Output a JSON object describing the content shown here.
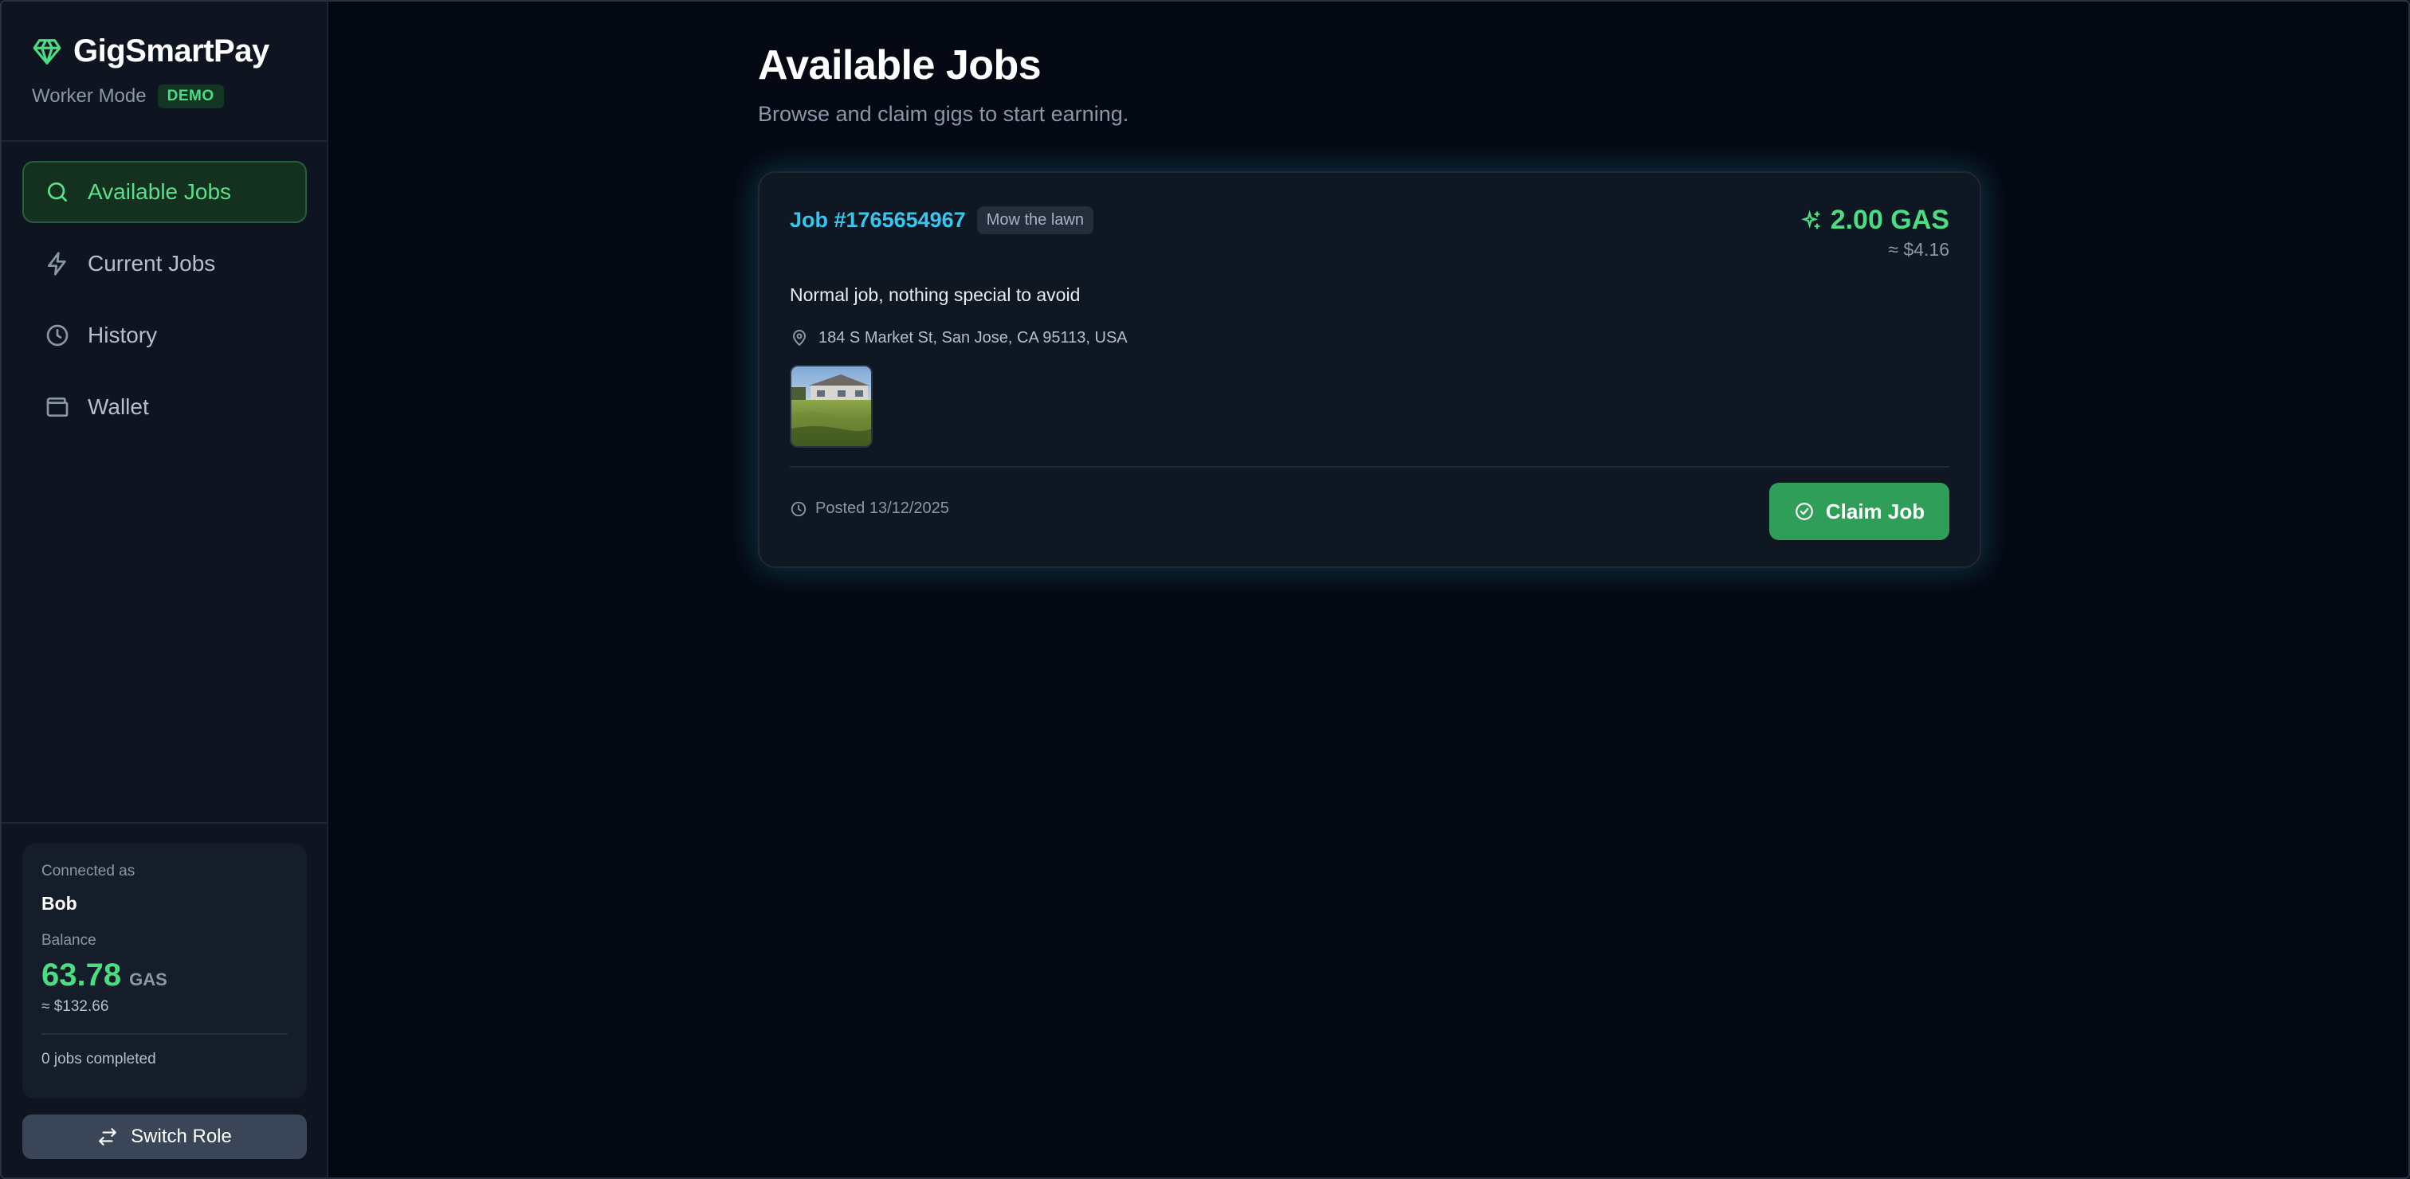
{
  "app": {
    "name": "GigSmartPay",
    "mode": "Worker Mode",
    "badge": "DEMO"
  },
  "sidebar": {
    "items": [
      {
        "label": "Available Jobs",
        "icon": "search-icon",
        "active": true
      },
      {
        "label": "Current Jobs",
        "icon": "lightning-icon",
        "active": false
      },
      {
        "label": "History",
        "icon": "clock-icon",
        "active": false
      },
      {
        "label": "Wallet",
        "icon": "wallet-icon",
        "active": false
      }
    ]
  },
  "account": {
    "connected_label": "Connected as",
    "name": "Bob",
    "balance_label": "Balance",
    "balance": "63.78",
    "unit": "GAS",
    "usd": "≈ $132.66",
    "jobs_completed": "0 jobs completed"
  },
  "switch_role": {
    "label": "Switch Role"
  },
  "page": {
    "title": "Available Jobs",
    "subtitle": "Browse and claim gigs to start earning."
  },
  "job": {
    "id_label": "Job #1765654967",
    "tag": "Mow the lawn",
    "price": "2.00 GAS",
    "price_usd": "≈ $4.16",
    "description": "Normal job, nothing special to avoid",
    "location": "184 S Market St, San Jose, CA 95113, USA",
    "posted": "Posted 13/12/2025",
    "claim_label": "Claim Job"
  },
  "colors": {
    "accent": "#4ade80",
    "link": "#38c5ee",
    "button": "#2f9e58",
    "background": "#040812"
  }
}
